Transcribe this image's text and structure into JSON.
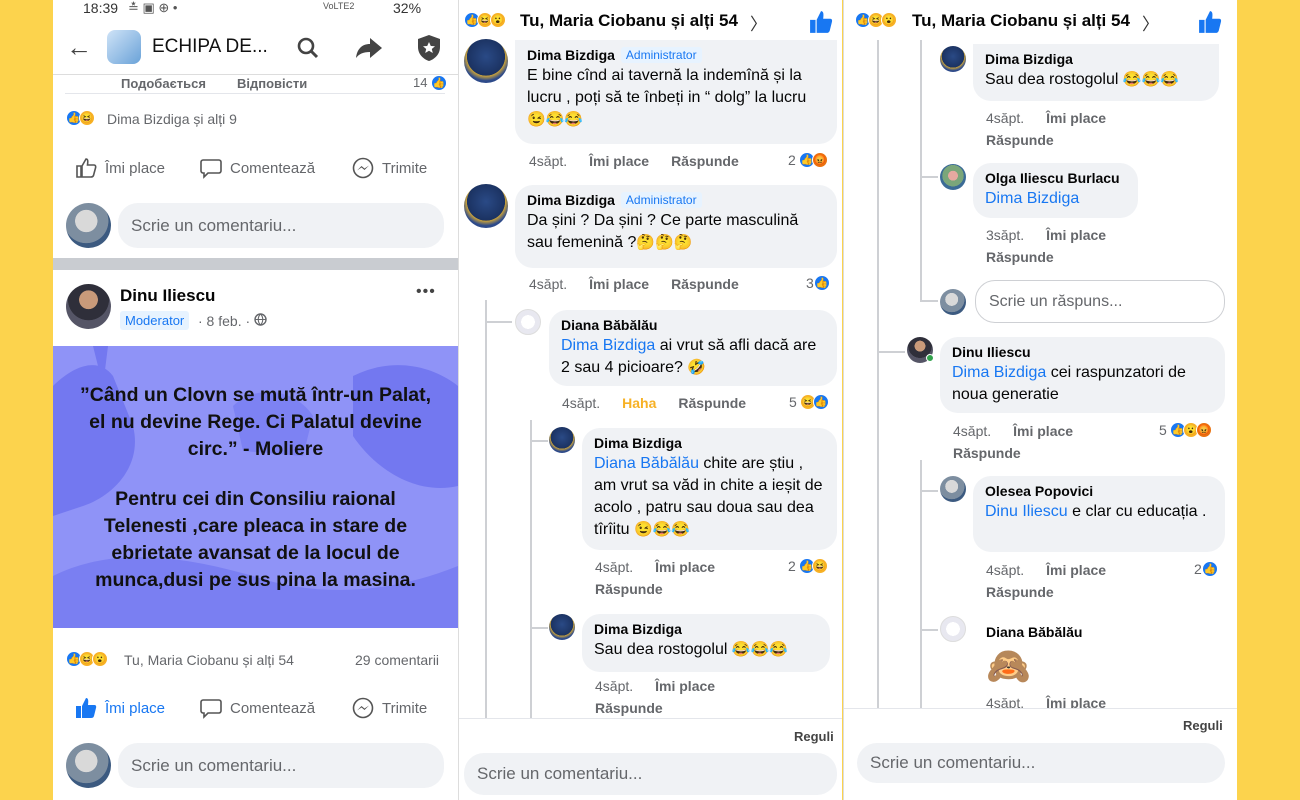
{
  "status_bar": {
    "time": "18:39",
    "icons_left": "≛ ▣ ⊕ •",
    "battery": "32%",
    "net": "VoLTE2"
  },
  "header": {
    "group_name": "ECHIPA DE...",
    "icons": [
      "back-arrow-icon",
      "search-icon",
      "share-icon",
      "shield-icon"
    ]
  },
  "prev_comment": {
    "like": "Подобається",
    "reply": "Відповісти",
    "count": "14"
  },
  "prev_post": {
    "reactions_text": "Dima  Bizdiga și alți 9",
    "actions": {
      "like": "Îmi place",
      "comment": "Comentează",
      "send": "Trimite"
    },
    "comment_placeholder": "Scrie un comentariu..."
  },
  "post": {
    "author": "Dinu Iliescu",
    "role": "Moderator",
    "date": "· 8 feb. ·",
    "more": "•••",
    "image_text": {
      "quote": "”Când un Clovn se mută într-un Palat, el nu devine Rege.  Ci Palatul devine circ.” - Moliere",
      "body": "Pentru cei din Consiliu raional Telenesti ,care pleaca in stare de ebrietate avansat de la locul de munca,dusi pe sus pina la masina."
    },
    "reactions_text": "Tu, Maria Ciobanu și alți 54",
    "comments_count": "29 comentarii",
    "actions": {
      "like": "Îmi place",
      "comment": "Comentează",
      "send": "Trimite"
    },
    "comment_placeholder": "Scrie un comentariu...",
    "colors": {
      "image_bg": "#8f93f7",
      "like_blue": "#1877f2"
    }
  },
  "comments_header": {
    "reactions_text": "Tu, Maria Ciobanu și alți 54",
    "chevron": "〉"
  },
  "panel2": {
    "c1": {
      "name": "Dima  Bizdiga",
      "badge": "Administrator",
      "text": "E bine cînd ai tavernă la indemînă și la lucru , poți să te înbeți in “ dolg” la lucru",
      "emoji": "😉😂😂",
      "time": "4săpt.",
      "like": "Îmi place",
      "reply": "Răspunde",
      "count": "2"
    },
    "c2": {
      "name": "Dima  Bizdiga",
      "badge": "Administrator",
      "text": "Da șini ? Da șini ? Ce parte masculină sau femenină ?",
      "emoji": "🤔🤔🤔",
      "time": "4săpt.",
      "like": "Îmi place",
      "reply": "Răspunde",
      "count": "3"
    },
    "c3": {
      "name": "Diana Băbălău",
      "mention": "Dima  Bizdiga",
      "text": " ai vrut să afli dacă are  2 sau 4 picioare?",
      "emoji": "🤣",
      "time": "4săpt.",
      "like": "Haha",
      "reply": "Răspunde",
      "count": "5"
    },
    "c4": {
      "name": "Dima  Bizdiga",
      "mention": "Diana Băbălău",
      "text": " chite are știu , am vrut sa văd in chite a ieșit de acolo , patru sau doua sau dea tîrîitu",
      "emoji": "😉😂😂",
      "time": "4săpt.",
      "like": "Îmi place",
      "reply": "Răspunde",
      "count": "2"
    },
    "c5": {
      "name": "Dima  Bizdiga",
      "text": "Sau dea rostogolul",
      "emoji": "😂😂😂",
      "time": "4săpt.",
      "like": "Îmi place",
      "reply": "Răspunde"
    },
    "rules": "Reguli",
    "comment_placeholder": "Scrie un comentariu..."
  },
  "panel3": {
    "c1": {
      "name": "Dima  Bizdiga",
      "text": "Sau dea rostogolul",
      "emoji": "😂😂😂",
      "time": "4săpt.",
      "like": "Îmi place",
      "reply": "Răspunde"
    },
    "c2": {
      "name": "Olga Iliescu Burlacu",
      "mention": "Dima  Bizdiga",
      "time": "3săpt.",
      "like": "Îmi place",
      "reply": "Răspunde"
    },
    "reply_placeholder": "Scrie un răspuns...",
    "c3": {
      "name": "Dinu Iliescu",
      "mention": "Dima  Bizdiga",
      "text": "  cei raspunzatori de noua generatie",
      "time": "4săpt.",
      "like": "Îmi place",
      "reply": "Răspunde",
      "count": "5"
    },
    "c4": {
      "name": "Olesea Popovici",
      "mention": "Dinu Iliescu",
      "text": " e clar cu educația  .",
      "time": "4săpt.",
      "like": "Îmi place",
      "reply": "Răspunde",
      "count": "2"
    },
    "c5": {
      "name": "Diana Băbălău",
      "emoji": "🙈",
      "time": "4săpt.",
      "like": "Îmi place"
    },
    "rules": "Reguli",
    "comment_placeholder": "Scrie un comentariu..."
  }
}
